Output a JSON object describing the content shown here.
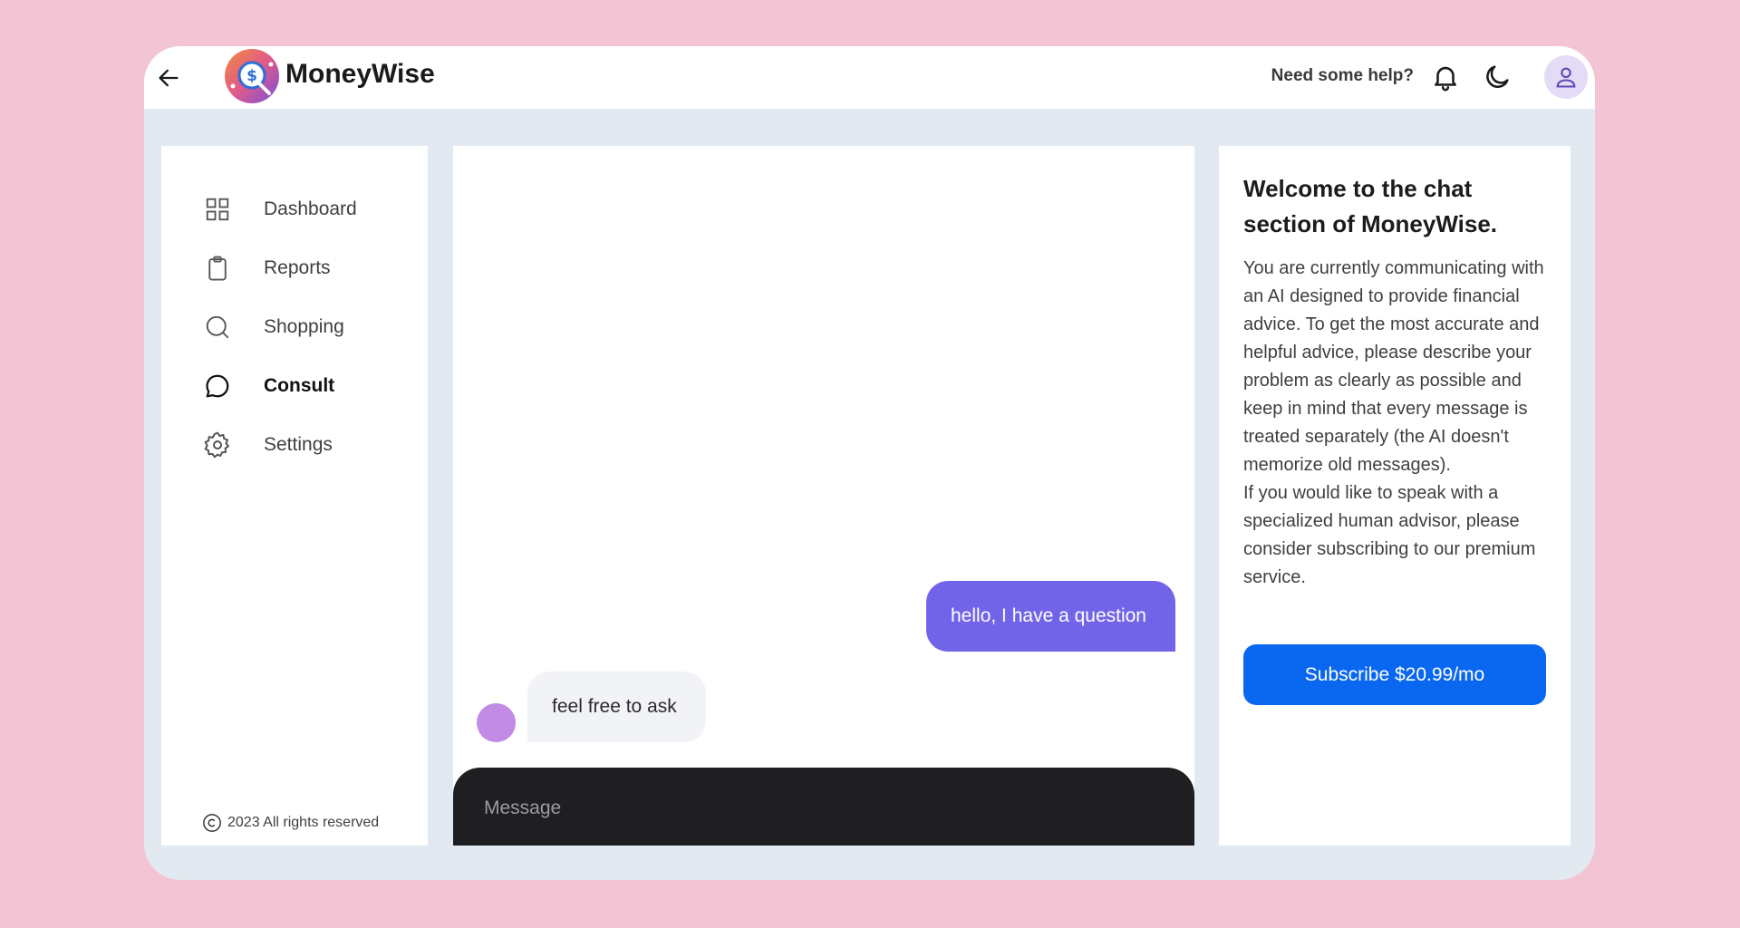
{
  "header": {
    "brand": "MoneyWise",
    "help_text": "Need some help?"
  },
  "sidebar": {
    "items": [
      {
        "label": "Dashboard",
        "icon": "grid-icon"
      },
      {
        "label": "Reports",
        "icon": "clipboard-icon"
      },
      {
        "label": "Shopping",
        "icon": "search-icon"
      },
      {
        "label": "Consult",
        "icon": "chat-bubble-icon",
        "active": true
      },
      {
        "label": "Settings",
        "icon": "gear-icon"
      }
    ],
    "footer": "2023 All rights reserved"
  },
  "chat": {
    "messages": [
      {
        "from": "user",
        "text": "hello, I have a question"
      },
      {
        "from": "bot",
        "text": "feel free to ask"
      }
    ],
    "input_placeholder": "Message"
  },
  "info": {
    "title": "Welcome to the chat section of MoneyWise.",
    "description": "You are currently communicating with an AI designed to provide financial advice. To get the most accurate and helpful advice, please describe your problem as clearly as possible and keep in mind that every message is treated separately (the AI doesn't memorize old messages).\nIf you would like to speak with a specialized human advisor, please consider subscribing to our premium service.",
    "subscribe_label": "Subscribe $20.99/mo"
  },
  "colors": {
    "page_bg": "#f3c4d4",
    "app_bg": "#e3e9f1",
    "user_bubble": "#7264e9",
    "bot_avatar": "#c28be6",
    "subscribe": "#0a68f0",
    "composer": "#1f1f22"
  }
}
